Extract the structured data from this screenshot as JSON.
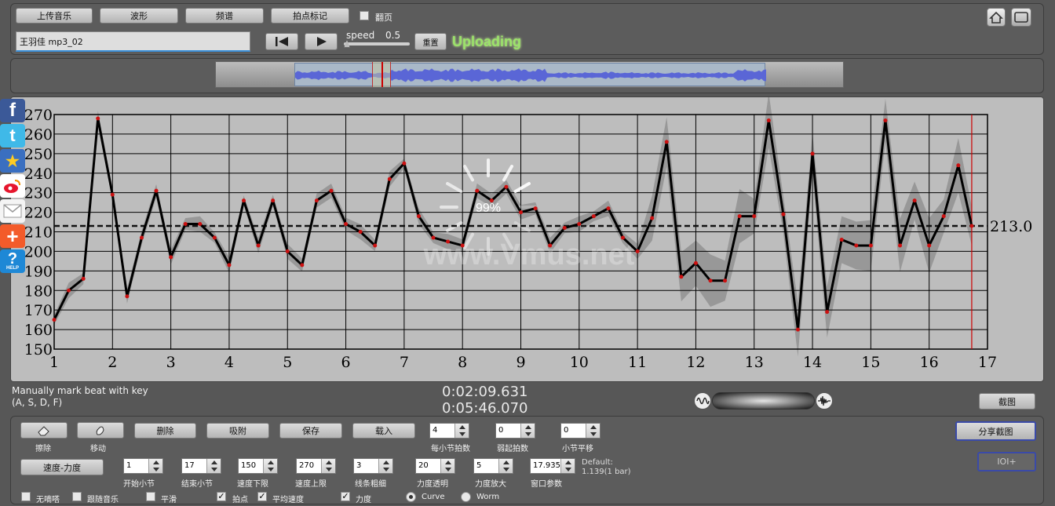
{
  "toolbar": {
    "upload_label": "上传音乐",
    "waveform_label": "波形",
    "spectrum_label": "频谱",
    "mark_label": "拍点标记",
    "flip_label": "翻页",
    "filename": "王羽佳 mp3_02",
    "speed_label": "speed",
    "speed_value": "0.5",
    "reset_label": "重置",
    "status": "Uploading"
  },
  "chart_overlay": {
    "progress": "99%",
    "watermark": "www.Vmus.net",
    "avg_label": "213.0"
  },
  "info": {
    "hint_line1": "Manually mark beat with key",
    "hint_line2": "(A, S, D, F)",
    "time_current": "0:02:09.631",
    "time_total": "0:05:46.070",
    "screenshot_label": "截图"
  },
  "controls": {
    "erase_label": "擦除",
    "move_label": "移动",
    "delete_label": "删除",
    "snap_label": "吸附",
    "save_label": "保存",
    "load_label": "载入",
    "beats_per_bar_label": "每小节拍数",
    "beats_per_bar": "4",
    "upbeat_label": "弱起拍数",
    "upbeat": "0",
    "bar_shift_label": "小节平移",
    "bar_shift": "0",
    "share_label": "分享截图",
    "ioi_label": "IOI+",
    "tempo_dyn_label": "速度-力度",
    "start_bar_label": "开始小节",
    "start_bar": "1",
    "end_bar_label": "结束小节",
    "end_bar": "17",
    "tempo_low_label": "速度下限",
    "tempo_low": "150",
    "tempo_high_label": "速度上限",
    "tempo_high": "270",
    "line_width_label": "线条粗细",
    "line_width": "3",
    "dyn_alpha_label": "力度透明",
    "dyn_alpha": "20",
    "dyn_zoom_label": "力度放大",
    "dyn_zoom": "5",
    "window_label": "窗口参数",
    "window_value": "17.935",
    "default_line1": "Default:",
    "default_line2": "1.139(1 bar)",
    "metronome_label": "无嘀嗒",
    "follow_label": "跟随音乐",
    "smooth_label": "平滑",
    "beat_label": "拍点",
    "avg_tempo_label": "平均速度",
    "dynamics_label": "力度",
    "curve_label": "Curve",
    "worm_label": "Worm"
  },
  "colors": {
    "status_green": "#9be36a",
    "beat_marker": "#cc1111",
    "band_gray": "#8c8c8c"
  },
  "chart_data": {
    "type": "line",
    "x_range": [
      1,
      17
    ],
    "y_range": [
      150,
      270
    ],
    "x_ticks": [
      1,
      2,
      3,
      4,
      5,
      6,
      7,
      8,
      9,
      10,
      11,
      12,
      13,
      14,
      15,
      16,
      17
    ],
    "y_ticks": [
      150,
      160,
      170,
      180,
      190,
      200,
      210,
      220,
      230,
      240,
      250,
      260,
      270
    ],
    "average": 213.0,
    "grid": true,
    "cursor_x": 16.73,
    "series": [
      {
        "x": [
          1,
          1.25,
          1.5,
          1.75,
          2,
          2.25,
          2.5,
          2.75,
          3,
          3.25,
          3.5,
          3.75,
          4,
          4.25,
          4.5,
          4.75,
          5,
          5.25,
          5.5,
          5.75,
          6,
          6.25,
          6.5,
          6.75,
          7,
          7.25,
          7.5,
          7.75,
          8,
          8.25,
          8.5,
          8.75,
          9,
          9.25,
          9.5,
          9.75,
          10,
          10.25,
          10.5,
          10.75,
          11,
          11.25,
          11.5,
          11.75,
          12,
          12.25,
          12.5,
          12.75,
          13,
          13.25,
          13.5,
          13.75,
          14,
          14.25,
          14.5,
          14.75,
          15,
          15.25,
          15.5,
          15.75,
          16,
          16.25,
          16.5,
          16.73
        ],
        "values": [
          165,
          180,
          186,
          268,
          229,
          177,
          207,
          231,
          197,
          214,
          214,
          207,
          193,
          226,
          203,
          226,
          200,
          193,
          226,
          231,
          214,
          210,
          203,
          237,
          245,
          218,
          207,
          205,
          203,
          231,
          226,
          233,
          220,
          222,
          203,
          212,
          214,
          218,
          222,
          207,
          200,
          217,
          256,
          187,
          194,
          185,
          185,
          218,
          218,
          267,
          219,
          160,
          250,
          169,
          206,
          203,
          203,
          267,
          203,
          226,
          203,
          218,
          244,
          213
        ]
      }
    ]
  }
}
